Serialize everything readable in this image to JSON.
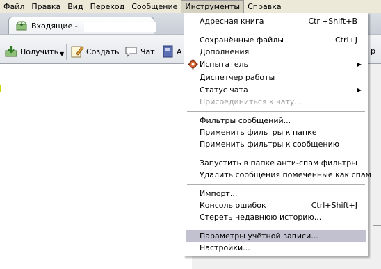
{
  "menubar": {
    "items": [
      "Файл",
      "Правка",
      "Вид",
      "Переход",
      "Сообщение",
      "Инструменты",
      "Справка"
    ],
    "active_index": 5
  },
  "tab": {
    "title": "Входящие -",
    "icon": "inbox-icon"
  },
  "toolbar": {
    "get_label": "Получить",
    "new_label": "Создать",
    "chat_label": "Чат",
    "addressbook_label_partial": "А",
    "right_cut_label": "р",
    "icons": {
      "get": "get-mail-icon",
      "new": "write-icon",
      "chat": "chat-bubble-icon",
      "addressbook": "address-book-icon"
    }
  },
  "tools_menu": {
    "items": [
      {
        "label": "Адресная книга",
        "shortcut": "Ctrl+Shift+B",
        "submenu": false,
        "disabled": false
      },
      {
        "separator": true
      },
      {
        "label": "Сохранённые файлы",
        "shortcut": "Ctrl+J",
        "submenu": false,
        "disabled": false
      },
      {
        "label": "Дополнения",
        "shortcut": "",
        "submenu": false,
        "disabled": false
      },
      {
        "label": "Испытатель",
        "shortcut": "",
        "submenu": true,
        "disabled": false,
        "icon": "tester-gear-icon"
      },
      {
        "label": "Диспетчер работы",
        "shortcut": "",
        "submenu": false,
        "disabled": false
      },
      {
        "label": "Статус чата",
        "shortcut": "",
        "submenu": true,
        "disabled": false
      },
      {
        "label": "Присоединиться к чату...",
        "shortcut": "",
        "submenu": false,
        "disabled": true
      },
      {
        "separator": true
      },
      {
        "label": "Фильтры сообщений...",
        "shortcut": "",
        "submenu": false,
        "disabled": false
      },
      {
        "label": "Применить фильтры к папке",
        "shortcut": "",
        "submenu": false,
        "disabled": false
      },
      {
        "label": "Применить фильтры к сообщению",
        "shortcut": "",
        "submenu": false,
        "disabled": false
      },
      {
        "separator": true
      },
      {
        "label": "Запустить в папке анти-спам фильтры",
        "shortcut": "",
        "submenu": false,
        "disabled": false
      },
      {
        "label": "Удалить сообщения помеченные как спам",
        "shortcut": "",
        "submenu": false,
        "disabled": false
      },
      {
        "separator": true
      },
      {
        "label": "Импорт...",
        "shortcut": "",
        "submenu": false,
        "disabled": false
      },
      {
        "label": "Консоль ошибок",
        "shortcut": "Ctrl+Shift+J",
        "submenu": false,
        "disabled": false
      },
      {
        "label": "Стереть недавнюю историю...",
        "shortcut": "",
        "submenu": false,
        "disabled": false
      },
      {
        "separator": true
      },
      {
        "label": "Параметры учётной записи...",
        "shortcut": "",
        "submenu": false,
        "disabled": false,
        "highlighted": true
      },
      {
        "label": "Настройки...",
        "shortcut": "",
        "submenu": false,
        "disabled": false
      }
    ]
  },
  "colors": {
    "menubar_bg": "#ece9d8",
    "highlight": "#c1c1cf",
    "disabled_text": "#a0a0a0"
  }
}
